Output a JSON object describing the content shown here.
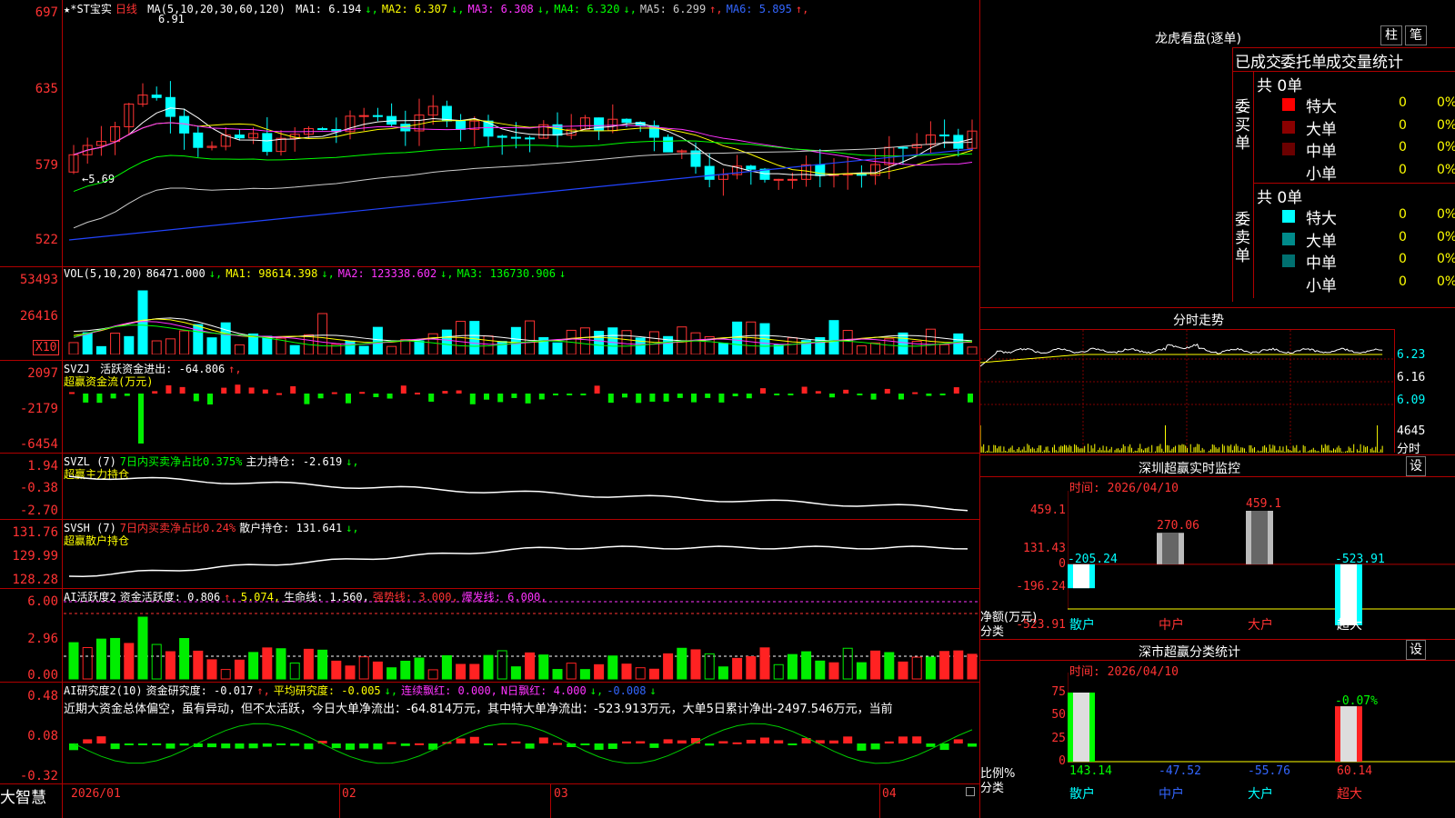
{
  "stock": {
    "name": "★*ST宝实",
    "period": "日线"
  },
  "main_chart": {
    "ma_header": "MA(5,10,20,30,60,120)",
    "ma_values": [
      {
        "label": "MA1: 6.194",
        "arrow": "↓",
        "color": "#ffffff"
      },
      {
        "label": "MA2: 6.307",
        "arrow": "↓",
        "color": "#ffff00"
      },
      {
        "label": "MA3: 6.308",
        "arrow": "↓",
        "color": "#ff33ff"
      },
      {
        "label": "MA4: 6.320",
        "arrow": "↓",
        "color": "#00ff00"
      },
      {
        "label": "MA5: 6.299",
        "arrow": "↑",
        "color": "#cccccc"
      },
      {
        "label": "MA6: 5.895",
        "arrow": "↑",
        "color": "#3366ff"
      }
    ],
    "high_label": "6.91",
    "low_label": "5.69",
    "y_labels": [
      "697",
      "635",
      "579",
      "522"
    ]
  },
  "vol": {
    "header": "VOL(5,10,20)",
    "value": "86471.000",
    "ma1": "MA1: 98614.398",
    "ma2": "MA2: 123338.602",
    "ma3": "MA3: 136730.906",
    "y_labels": [
      "53493",
      "26416"
    ],
    "unit": "X10"
  },
  "svzj": {
    "header": "SVZJ",
    "title": "活跃资金进出: -64.806",
    "sub": "超赢资金流(万元)",
    "y_labels": [
      "2097",
      "-2179",
      "-6454"
    ]
  },
  "svzl": {
    "header": "SVZL (7)",
    "ratio": "7日内买卖净占比0.375%",
    "hold": "主力持仓: -2.619",
    "sub": "超赢主力持仓",
    "y_labels": [
      "1.94",
      "-0.38",
      "-2.70"
    ]
  },
  "svsh": {
    "header": "SVSH (7)",
    "ratio": "7日内买卖净占比0.24%",
    "hold": "散户持仓: 131.641",
    "sub": "超赢散户持仓",
    "y_labels": [
      "131.76",
      "129.99",
      "128.28"
    ]
  },
  "ai_active": {
    "header": "AI活跃度2",
    "active": "资金活跃度: 0.806",
    "v2": "5.074,",
    "life": "生命线: 1.560,",
    "strong": "强势线: 3.000,",
    "burst": "爆发线: 6.000,",
    "y_labels": [
      "6.00",
      "2.96",
      "0.00"
    ]
  },
  "ai_research": {
    "header": "AI研究度2(10)",
    "res": "资金研究度: -0.017",
    "avg": "平均研究度: -0.005",
    "lianxu": "连续飘红: 0.000,",
    "nday": "N日飘红: 4.000",
    "last": "-0.008",
    "comment": "近期大资金总体偏空，虽有异动，但不太活跃，今日大单净流出：-64.814万元，其中特大单净流出：-523.913万元，大单5日累计净出-2497.546万元，当前",
    "y_labels": [
      "0.48",
      "0.08",
      "-0.32"
    ]
  },
  "x_axis": {
    "labels": [
      "2026/01",
      "02",
      "03",
      "04"
    ]
  },
  "brand": "大智慧",
  "right": {
    "title": "龙虎看盘(逐单)",
    "btn_zhu": "柱",
    "btn_bi": "笔",
    "tabs": [
      "已成交",
      "委托单",
      "成交量统计"
    ],
    "buy": {
      "side": "委买单",
      "total": "共 0单",
      "rows": [
        {
          "label": "特大",
          "n": "0",
          "p": "0%",
          "color": "#ff0000"
        },
        {
          "label": "大单",
          "n": "0",
          "p": "0%",
          "color": "#8b0000"
        },
        {
          "label": "中单",
          "n": "0",
          "p": "0%",
          "color": "#6b0000"
        },
        {
          "label": "小单",
          "n": "0",
          "p": "0%",
          "color": "#000000"
        }
      ]
    },
    "sell": {
      "side": "委卖单",
      "total": "共 0单",
      "rows": [
        {
          "label": "特大",
          "n": "0",
          "p": "0%",
          "color": "#00ffff"
        },
        {
          "label": "大单",
          "n": "0",
          "p": "0%",
          "color": "#008b8b"
        },
        {
          "label": "中单",
          "n": "0",
          "p": "0%",
          "color": "#007070"
        },
        {
          "label": "小单",
          "n": "0",
          "p": "0%",
          "color": "#000000"
        }
      ]
    },
    "fenshi": {
      "title": "分时走势",
      "y_labels": [
        "6.23",
        "6.16",
        "6.09"
      ],
      "vol_label": "4645",
      "vol_unit": "分时"
    },
    "sz_monitor": {
      "title": "深圳超赢实时监控",
      "btn": "设",
      "time": "时间: 2026/04/10",
      "y_labels": [
        "459.1",
        "131.43",
        "0",
        "-196.24",
        "-523.91"
      ],
      "axis_a": "净额(万元)",
      "axis_b": "分类",
      "bars": [
        {
          "cat": "散户",
          "value": -205.24,
          "label": "-205.24"
        },
        {
          "cat": "中户",
          "value": 270.06,
          "label": "270.06"
        },
        {
          "cat": "大户",
          "value": 459.1,
          "label": "459.1"
        },
        {
          "cat": "超大",
          "value": -523.91,
          "label": "-523.91"
        }
      ]
    },
    "sz_class": {
      "title": "深市超赢分类统计",
      "btn": "设",
      "time": "时间: 2026/04/10",
      "y_labels": [
        "75",
        "50",
        "25",
        "0"
      ],
      "axis_a": "比例%",
      "axis_b": "分类",
      "bars": [
        {
          "cat": "散户",
          "value": 143.14,
          "label": "143.14"
        },
        {
          "cat": "中户",
          "value": -47.52,
          "label": "-47.52"
        },
        {
          "cat": "大户",
          "value": -55.76,
          "label": "-55.76"
        },
        {
          "cat": "超大",
          "value": 60.14,
          "label": "60.14",
          "top": "-0.07%"
        }
      ]
    }
  },
  "chart_data": [
    {
      "type": "bar",
      "title": "深圳超赢实时监控",
      "ylabel": "净额(万元)",
      "xlabel": "分类",
      "categories": [
        "散户",
        "中户",
        "大户",
        "超大"
      ],
      "values": [
        -205.24,
        270.06,
        459.1,
        -523.91
      ],
      "ylim": [
        -523.91,
        459.1
      ]
    },
    {
      "type": "bar",
      "title": "深市超赢分类统计",
      "ylabel": "比例%",
      "xlabel": "分类",
      "categories": [
        "散户",
        "中户",
        "大户",
        "超大"
      ],
      "values": [
        143.14,
        -47.52,
        -55.76,
        60.14
      ],
      "ylim": [
        0,
        75
      ]
    }
  ]
}
